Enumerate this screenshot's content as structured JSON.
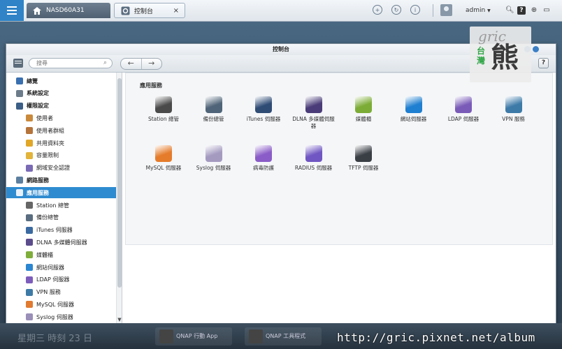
{
  "topbar": {
    "tabs": [
      {
        "label": "NASD60A31"
      },
      {
        "label": "控制台",
        "close": "×"
      }
    ],
    "user": "admin",
    "user_caret": "▼"
  },
  "window": {
    "title": "控制台",
    "search_placeholder": "搜尋",
    "help": "?"
  },
  "sidebar": {
    "items": [
      {
        "label": "總覽",
        "level": "top",
        "icon": "overview-icon",
        "color": "#3a6fb0"
      },
      {
        "label": "系統設定",
        "level": "top",
        "icon": "gear-icon",
        "color": "#6d7c8a"
      },
      {
        "label": "權限設定",
        "level": "top",
        "icon": "user-icon",
        "color": "#3b5f86"
      },
      {
        "label": "使用者",
        "level": "sub",
        "icon": "user-icon",
        "color": "#c98a3c"
      },
      {
        "label": "使用者群組",
        "level": "sub",
        "icon": "group-icon",
        "color": "#b5743a"
      },
      {
        "label": "共用資料夾",
        "level": "sub",
        "icon": "folder-icon",
        "color": "#e1a727"
      },
      {
        "label": "容量限制",
        "level": "sub",
        "icon": "quota-icon",
        "color": "#e2b43a"
      },
      {
        "label": "網域安全認證",
        "level": "sub",
        "icon": "domain-icon",
        "color": "#7a6ab4"
      },
      {
        "label": "網路服務",
        "level": "top",
        "icon": "globe-icon",
        "color": "#5c7f9f"
      },
      {
        "label": "應用服務",
        "level": "top",
        "icon": "app-icon",
        "color": "#e8f1fa",
        "active": true
      },
      {
        "label": "Station 總管",
        "level": "sub",
        "icon": "station-icon",
        "color": "#666"
      },
      {
        "label": "備份總管",
        "level": "sub",
        "icon": "backup-icon",
        "color": "#5a6d80"
      },
      {
        "label": "iTunes 伺服器",
        "level": "sub",
        "icon": "itunes-icon",
        "color": "#3a6aa0"
      },
      {
        "label": "DLNA 多媒體伺服器",
        "level": "sub",
        "icon": "dlna-icon",
        "color": "#5b4c8c"
      },
      {
        "label": "媒體櫃",
        "level": "sub",
        "icon": "media-icon",
        "color": "#7fae3b"
      },
      {
        "label": "網站伺服器",
        "level": "sub",
        "icon": "web-icon",
        "color": "#2b86d1"
      },
      {
        "label": "LDAP 伺服器",
        "level": "sub",
        "icon": "ldap-icon",
        "color": "#7d5dbb"
      },
      {
        "label": "VPN 服務",
        "level": "sub",
        "icon": "vpn-icon",
        "color": "#3e7aa6"
      },
      {
        "label": "MySQL 伺服器",
        "level": "sub",
        "icon": "mysql-icon",
        "color": "#e07b2f"
      },
      {
        "label": "Syslog 伺服器",
        "level": "sub",
        "icon": "syslog-icon",
        "color": "#9a8fb8"
      }
    ]
  },
  "main": {
    "section_title": "應用服務",
    "apps": [
      {
        "label": "Station 總管",
        "icon": "station-icon",
        "color": "#4a4a4a"
      },
      {
        "label": "備份總管",
        "icon": "backup-icon",
        "color": "#4f6478"
      },
      {
        "label": "iTunes 伺服器",
        "icon": "itunes-icon",
        "color": "#2f4c75"
      },
      {
        "label": "DLNA 多媒體伺服器",
        "icon": "dlna-icon",
        "color": "#4a3c78"
      },
      {
        "label": "媒體櫃",
        "icon": "media-icon",
        "color": "#7cac36"
      },
      {
        "label": "網站伺服器",
        "icon": "web-icon",
        "color": "#1f7fd0"
      },
      {
        "label": "LDAP 伺服器",
        "icon": "ldap-icon",
        "color": "#7a5bb8"
      },
      {
        "label": "VPN 服務",
        "icon": "vpn-icon",
        "color": "#3d7aa8"
      },
      {
        "label": "MySQL 伺服器",
        "icon": "mysql-icon",
        "color": "#e57c2b"
      },
      {
        "label": "Syslog 伺服器",
        "icon": "syslog-icon",
        "color": "#a49ac0"
      },
      {
        "label": "病毒防護",
        "icon": "antivirus-icon",
        "color": "#8a5cc7"
      },
      {
        "label": "RADIUS 伺服器",
        "icon": "radius-icon",
        "color": "#6f56c2"
      },
      {
        "label": "TFTP 伺服器",
        "icon": "tftp-icon",
        "color": "#3a3f46"
      }
    ]
  },
  "taskbar": {
    "clock": "星期三 時刻 23 日",
    "apps": [
      "QNAP 行動 App",
      "QNAP 工具程式"
    ]
  },
  "watermark": {
    "url": "http://gric.pixnet.net/album",
    "logo_latin": "gric",
    "logo_cjk_small": "台灣",
    "logo_cjk_big": "熊"
  }
}
